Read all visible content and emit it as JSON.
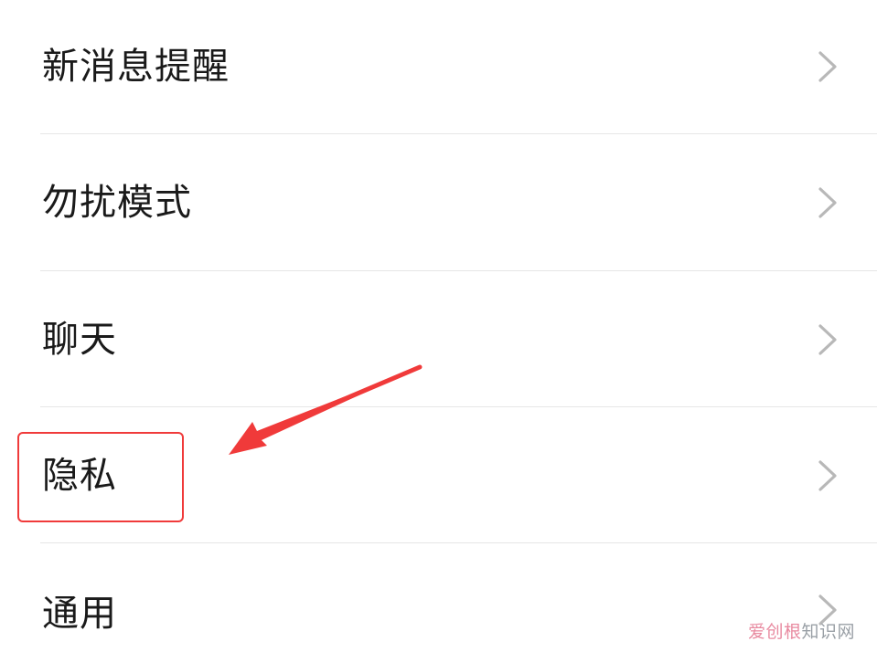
{
  "settings_list": {
    "items": [
      {
        "label": "新消息提醒",
        "icon": "chevron-right-icon"
      },
      {
        "label": "勿扰模式",
        "icon": "chevron-right-icon"
      },
      {
        "label": "聊天",
        "icon": "chevron-right-icon"
      },
      {
        "label": "隐私",
        "icon": "chevron-right-icon"
      },
      {
        "label": "通用",
        "icon": "chevron-right-icon"
      }
    ]
  },
  "annotation": {
    "highlight_color": "#f03a3a",
    "arrow_color": "#f03a3a"
  },
  "watermark": {
    "accent": "爱创根",
    "rest": "知识网"
  },
  "colors": {
    "text": "#1a1a1a",
    "chevron": "#b8b8b8",
    "divider": "#e6e6e6",
    "background": "#ffffff"
  }
}
